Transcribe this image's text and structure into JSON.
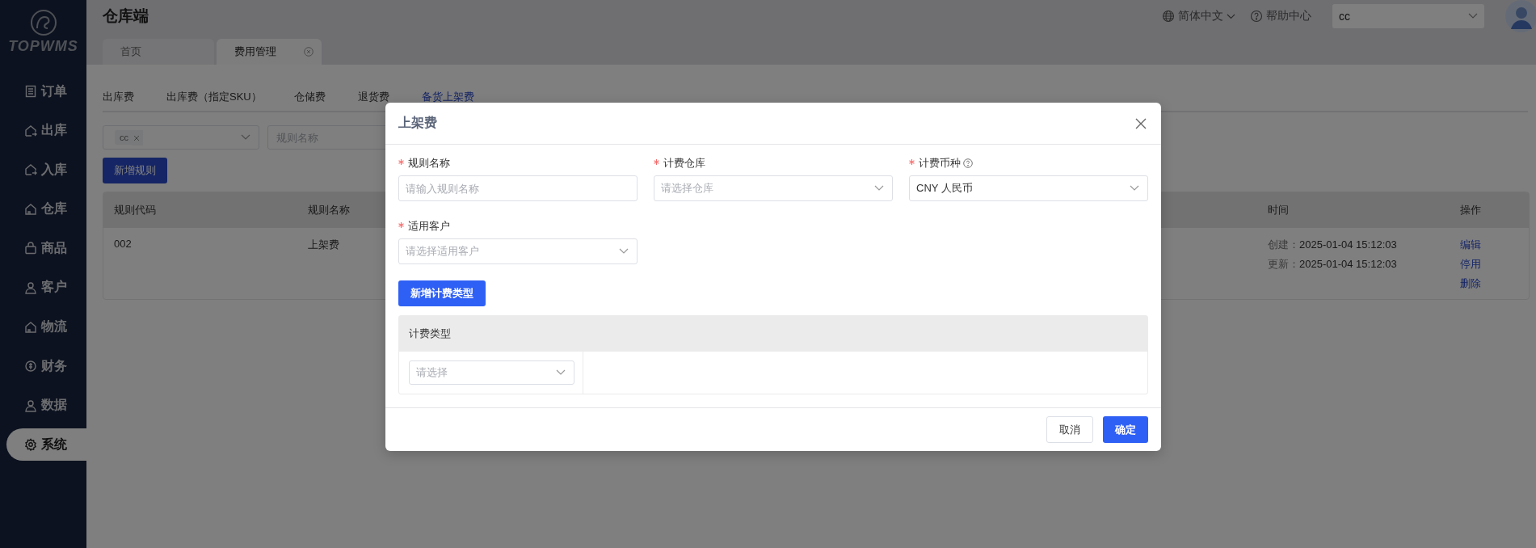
{
  "sidebar": {
    "logo_text": "TOPWMS",
    "items": [
      {
        "label": "订单",
        "selected": false
      },
      {
        "label": "出库",
        "selected": false
      },
      {
        "label": "入库",
        "selected": false
      },
      {
        "label": "仓库",
        "selected": false
      },
      {
        "label": "商品",
        "selected": false
      },
      {
        "label": "客户",
        "selected": false
      },
      {
        "label": "物流",
        "selected": false
      },
      {
        "label": "财务",
        "selected": false
      },
      {
        "label": "数据",
        "selected": false
      },
      {
        "label": "系统",
        "selected": true
      }
    ]
  },
  "header": {
    "title": "仓库端",
    "language": "简体中文",
    "help": "帮助中心",
    "account_select": "cc"
  },
  "page_tabs": [
    {
      "label": "首页",
      "selected": false,
      "closable": false
    },
    {
      "label": "费用管理",
      "selected": true,
      "closable": true
    }
  ],
  "fee_tabs": [
    {
      "label": "出库费",
      "selected": false
    },
    {
      "label": "出库费（指定SKU）",
      "selected": false
    },
    {
      "label": "仓储费",
      "selected": false
    },
    {
      "label": "退货费",
      "selected": false
    },
    {
      "label": "备货上架费",
      "selected": true
    }
  ],
  "filters": {
    "customer_tag": "cc",
    "rule_name_placeholder": "规则名称"
  },
  "add_rule_button": "新增规则",
  "table": {
    "columns": [
      "规则代码",
      "规则名称",
      "时间",
      "操作"
    ],
    "rows": [
      {
        "code": "002",
        "name": "上架费",
        "times": [
          {
            "label": "创建：",
            "value": "2025-01-04 15:12:03"
          },
          {
            "label": "更新：",
            "value": "2025-01-04 15:12:03"
          }
        ],
        "actions": [
          "编辑",
          "停用",
          "删除"
        ]
      }
    ]
  },
  "modal": {
    "title": "上架费",
    "fields": [
      {
        "label": "规则名称",
        "required": true,
        "kind": "input",
        "placeholder": "请输入规则名称",
        "help": false
      },
      {
        "label": "计费仓库",
        "required": true,
        "kind": "select",
        "placeholder": "请选择仓库",
        "help": false
      },
      {
        "label": "计费币种",
        "required": true,
        "kind": "select",
        "value": "CNY 人民币",
        "help": true
      },
      {
        "label": "适用客户",
        "required": true,
        "kind": "select",
        "placeholder": "请选择适用客户",
        "help": false
      }
    ],
    "add_type_button": "新增计费类型",
    "type_table": {
      "column": "计费类型",
      "rows": [
        {
          "placeholder": "请选择"
        }
      ]
    },
    "cancel_button": "取消",
    "confirm_button": "确定"
  }
}
